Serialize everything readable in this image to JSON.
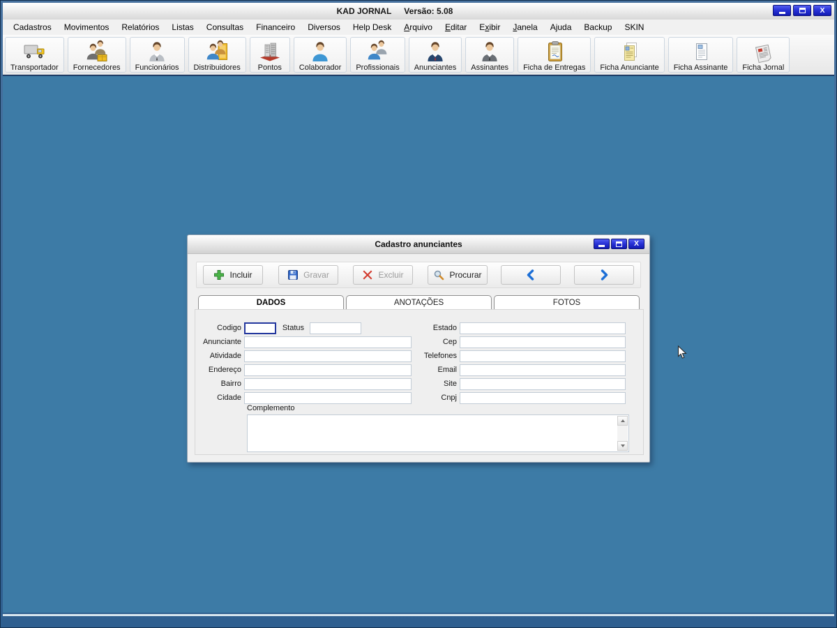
{
  "window": {
    "title": "KAD JORNAL",
    "version": "Versão: 5.08",
    "controls": [
      {
        "name": "minimize",
        "icon": "minimize-icon"
      },
      {
        "name": "maximize",
        "icon": "maximize-icon"
      },
      {
        "name": "close",
        "icon": "close-icon",
        "glyph": "X"
      }
    ]
  },
  "menu": {
    "items": [
      {
        "label": "Cadastros",
        "underline": -1
      },
      {
        "label": "Movimentos",
        "underline": -1
      },
      {
        "label": "Relatórios",
        "underline": -1
      },
      {
        "label": "Listas",
        "underline": -1
      },
      {
        "label": "Consultas",
        "underline": -1
      },
      {
        "label": "Financeiro",
        "underline": -1
      },
      {
        "label": "Diversos",
        "underline": -1
      },
      {
        "label": "Help Desk",
        "underline": -1
      },
      {
        "label": "Arquivo",
        "underline": 0
      },
      {
        "label": "Editar",
        "underline": 0
      },
      {
        "label": "Exibir",
        "underline": 1
      },
      {
        "label": "Janela",
        "underline": 0
      },
      {
        "label": "Ajuda",
        "underline": -1
      },
      {
        "label": "Backup",
        "underline": -1
      },
      {
        "label": "SKIN",
        "underline": -1
      }
    ]
  },
  "toolbar": {
    "buttons": [
      {
        "label": "Transportador",
        "icon": "truck-icon"
      },
      {
        "label": "Fornecedores",
        "icon": "suppliers-people-icon"
      },
      {
        "label": "Funcionários",
        "icon": "employee-person-icon"
      },
      {
        "label": "Distribuidores",
        "icon": "distributors-people-icon"
      },
      {
        "label": "Pontos",
        "icon": "building-icon"
      },
      {
        "label": "Colaborador",
        "icon": "collaborator-person-icon"
      },
      {
        "label": "Profissionais",
        "icon": "professionals-people-icon"
      },
      {
        "label": "Anunciantes",
        "icon": "advertiser-person-icon"
      },
      {
        "label": "Assinantes",
        "icon": "subscriber-person-icon"
      },
      {
        "label": "Ficha de Entregas",
        "icon": "clipboard-icon"
      },
      {
        "label": "Ficha Anunciante",
        "icon": "document-yellow-icon"
      },
      {
        "label": "Ficha Assinante",
        "icon": "document-white-icon"
      },
      {
        "label": "Ficha Jornal",
        "icon": "newspaper-icon"
      }
    ]
  },
  "dialog": {
    "title": "Cadastro anunciantes",
    "controls": [
      {
        "name": "minimize",
        "icon": "minimize-icon"
      },
      {
        "name": "maximize",
        "icon": "maximize-icon"
      },
      {
        "name": "close",
        "icon": "close-icon",
        "glyph": "X"
      }
    ],
    "toolbar_buttons": [
      {
        "name": "incluir-button",
        "label": "Incluir",
        "icon": "plus-icon",
        "enabled": true
      },
      {
        "name": "gravar-button",
        "label": "Gravar",
        "icon": "save-icon",
        "enabled": false
      },
      {
        "name": "excluir-button",
        "label": "Excluir",
        "icon": "delete-x-icon",
        "enabled": false
      },
      {
        "name": "procurar-button",
        "label": "Procurar",
        "icon": "search-icon",
        "enabled": true
      },
      {
        "name": "previous-record-button",
        "label": "",
        "icon": "chevron-left-icon",
        "enabled": true
      },
      {
        "name": "next-record-button",
        "label": "",
        "icon": "chevron-right-icon",
        "enabled": true
      }
    ],
    "tabs": [
      {
        "label": "DADOS",
        "active": true
      },
      {
        "label": "ANOTAÇÕES",
        "active": false
      },
      {
        "label": "FOTOS",
        "active": false
      }
    ],
    "form": {
      "codigo": {
        "label": "Codigo",
        "value": ""
      },
      "status": {
        "label": "Status",
        "value": ""
      },
      "left_fields": [
        {
          "label": "Anunciante",
          "value": ""
        },
        {
          "label": "Atividade",
          "value": ""
        },
        {
          "label": "Endereço",
          "value": ""
        },
        {
          "label": "Bairro",
          "value": ""
        },
        {
          "label": "Cidade",
          "value": ""
        }
      ],
      "right_fields": [
        {
          "label": "Estado",
          "value": ""
        },
        {
          "label": "Cep",
          "value": ""
        },
        {
          "label": "Telefones",
          "value": ""
        },
        {
          "label": "Email",
          "value": ""
        },
        {
          "label": "Site",
          "value": ""
        },
        {
          "label": "Cnpj",
          "value": ""
        }
      ],
      "complemento": {
        "label": "Complemento",
        "value": ""
      }
    }
  },
  "colors": {
    "desktop": "#3d7ba6",
    "titlebar_button_blue": "#1a22c4",
    "accent_chevron_blue": "#1d6fd6",
    "disabled_text": "#9b9b9b",
    "toolbar_separator": "#1c3a64"
  }
}
